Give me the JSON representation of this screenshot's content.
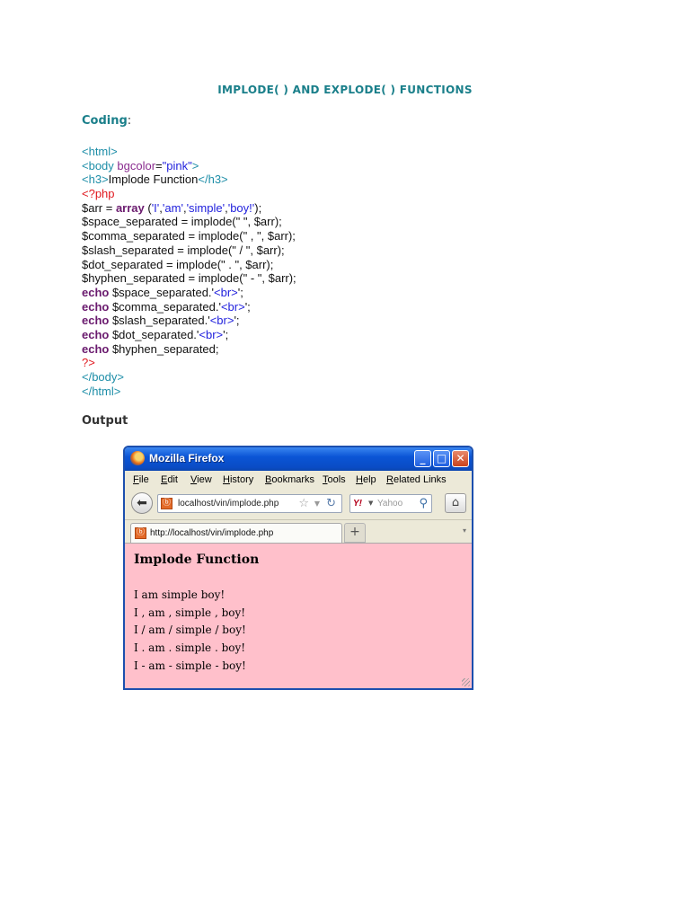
{
  "document": {
    "title": "IMPLODE( ) AND EXPLODE( ) FUNCTIONS",
    "coding_label": "Coding",
    "coding_colon": ":",
    "output_label": "Output"
  },
  "code": {
    "l1_tag": "<html>",
    "l2_open": "<body ",
    "l2_attr": "bgcolor",
    "l2_eq": "=",
    "l2_val": "\"pink\"",
    "l2_close": ">",
    "l3_open": "<h3>",
    "l3_text": "Implode Function",
    "l3_close": "</h3>",
    "l4_php": "<?php",
    "l5_a": "$arr = ",
    "l5_kw": "array",
    "l5_b": " (",
    "l5_s1": "'I'",
    "l5_c1": ",",
    "l5_s2": "'am'",
    "l5_c2": ",",
    "l5_s3": "'simple'",
    "l5_c3": ",",
    "l5_s4": "'boy!'",
    "l5_end": ");",
    "l6": "$space_separated = implode(\" \", $arr);",
    "l7": "$comma_separated = implode(\" , \", $arr);",
    "l8": "$slash_separated = implode(\" / \", $arr);",
    "l9": "$dot_separated = implode(\" . \", $arr);",
    "l10": "$hyphen_separated = implode(\" - \", $arr);",
    "echo_kw": "echo",
    "l11_var": " $space_separated.'",
    "l12_var": " $comma_separated.'",
    "l13_var": " $slash_separated.'",
    "l14_var": " $dot_separated.'",
    "br_tag": "<br>",
    "br_end": "';",
    "l15_var": " $hyphen_separated;",
    "l16_php": "?>",
    "l17_tag": "</body>",
    "l18_tag": "</html>"
  },
  "browser": {
    "window_title": "Mozilla Firefox",
    "menu": [
      "File",
      "Edit",
      "View",
      "History",
      "Bookmarks",
      "Tools",
      "Help",
      "Related Links"
    ],
    "url": "localhost/vin/implode.php",
    "search_placeholder": "Yahoo",
    "search_engine": "Y!",
    "tab_title": "http://localhost/vin/implode.php",
    "page": {
      "heading": "Implode Function",
      "lines": [
        "I am simple boy!",
        "I , am , simple , boy!",
        "I / am / simple / boy!",
        "I . am . simple . boy!",
        "I - am - simple - boy!"
      ],
      "background_color": "#ffc0cb"
    },
    "icons": {
      "back": "back-arrow-icon",
      "bookmark": "star-icon",
      "reload": "reload-icon",
      "search": "magnifier-icon",
      "home": "home-icon"
    }
  }
}
